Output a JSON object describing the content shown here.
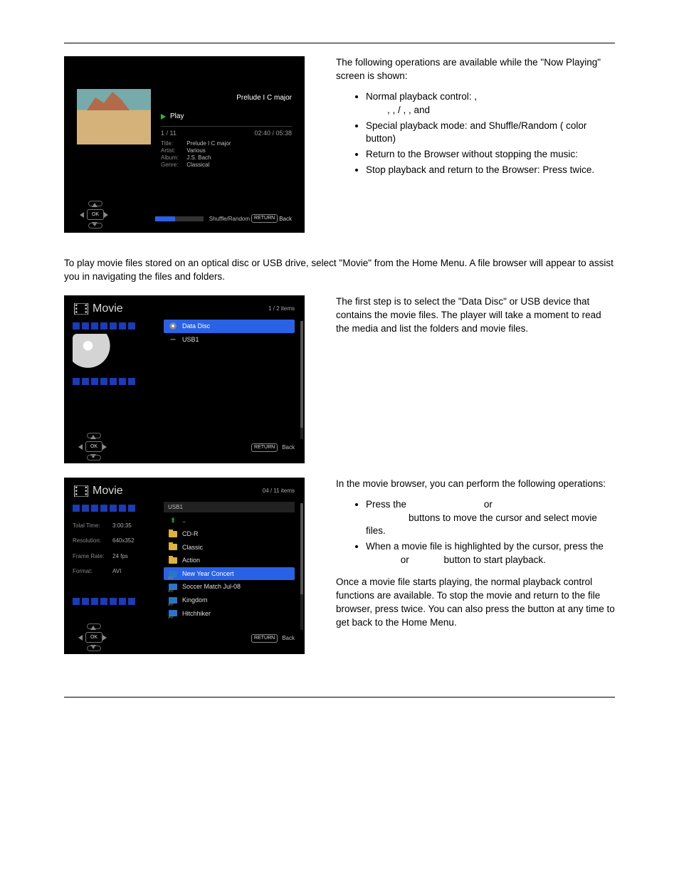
{
  "top_intro": "The following operations are available while the \"Now Playing\" screen is shown:",
  "np_list": [
    "Normal playback control:         ,",
    "Special playback mode:              and Shuffle/Random (        color button)",
    "Return to the Browser without stopping the music:",
    "Stop playback and return to the Browser: Press            twice."
  ],
  "np_subline": "         ,          ,              /          ,        , and",
  "now_playing": {
    "track_title": "Prelude I C major",
    "play_label": "Play",
    "counter": "1 / 11",
    "time": "02:40 / 05:38",
    "title_k": "Title:",
    "title_v": "Prelude I C major",
    "artist_k": "Artist:",
    "artist_v": "Various",
    "album_k": "Album:",
    "album_v": "J.S. Bach",
    "genre_k": "Genre:",
    "genre_v": "Classical",
    "shuffle": "Shuffle/Random",
    "return": "RETURN",
    "back": "Back",
    "ok": "OK"
  },
  "mid_para": "To play movie files stored on an optical disc or USB drive, select \"Movie\" from the Home Menu.  A file browser will appear to assist you in navigating the files and folders.",
  "mv1_right": "The first step is to select the \"Data Disc\" or USB device that contains the movie files.  The player will take a moment to read the media and list the folders and movie files.",
  "mv1": {
    "header": "Movie",
    "count": "1 / 2 items",
    "items": [
      "Data Disc",
      "USB1"
    ],
    "return": "RETURN",
    "back": "Back",
    "ok": "OK"
  },
  "mv2_p1": "In the movie browser, you can perform the following operations:",
  "mv2_li1a": "Press the ",
  "mv2_li1b": " or ",
  "mv2_li1c": " buttons to move the cursor and select movie files.",
  "mv2_li2a": "When a movie file is highlighted by the cursor, press the ",
  "mv2_li2b": " or ",
  "mv2_li2c": " button to start playback.",
  "mv2_p2": "Once a movie file starts playing, the normal playback control functions are available.  To stop the movie and return to the file browser, press            twice.  You can also press the             button at any time to get back to the Home Menu.",
  "mv2": {
    "header": "Movie",
    "count": "04 / 11 items",
    "bl_head": "USB1",
    "total_k": "Total Time:",
    "total_v": "3:00:35",
    "res_k": "Resolution:",
    "res_v": "640x352",
    "fps_k": "Frame Rate:",
    "fps_v": "24 fps",
    "fmt_k": "Format:",
    "fmt_v": "AVI",
    "items": [
      "..",
      "CD-R",
      "Classic",
      "Action",
      "New Year Concert",
      "Soccer Match Jul-08",
      "Kingdom",
      "Hitchhiker"
    ],
    "return": "RETURN",
    "back": "Back",
    "ok": "OK"
  }
}
